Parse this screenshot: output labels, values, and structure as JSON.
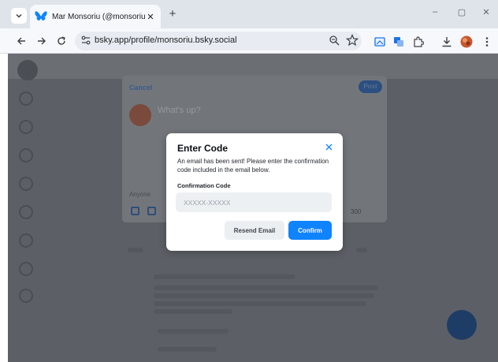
{
  "browser": {
    "tab_title": "Mar Monsoriu (@monsoriu.bsk",
    "tab_close": "✕",
    "new_tab": "+",
    "window_controls": {
      "minimize": "–",
      "maximize": "▢",
      "close": "✕"
    },
    "url": "bsky.app/profile/monsoriu.bsky.social",
    "icons": [
      "tab-search-icon",
      "bluesky-favicon",
      "back-icon",
      "forward-icon",
      "reload-icon",
      "site-info-icon",
      "zoom-icon",
      "star-icon",
      "screen-cast-icon",
      "translate-icon",
      "extensions-icon",
      "download-icon",
      "profile-avatar",
      "more-icon"
    ]
  },
  "composer": {
    "cancel_label": "Cancel",
    "post_label": "Post",
    "placeholder": "What's up?",
    "audience_label": "Anyone",
    "char_count": "300"
  },
  "modal": {
    "title": "Enter Code",
    "close_icon": "close-icon",
    "description": "An email has been sent! Please enter the confirmation code included in the email below.",
    "field_label": "Confirmation Code",
    "field_placeholder": "XXXXX-XXXXX",
    "field_value": "",
    "resend_label": "Resend Email",
    "confirm_label": "Confirm"
  },
  "colors": {
    "accent": "#1083fe",
    "overlay": "#5c6066",
    "chrome_tabstrip": "#dfe3ea",
    "chrome_toolbar": "#f6f8fb"
  }
}
